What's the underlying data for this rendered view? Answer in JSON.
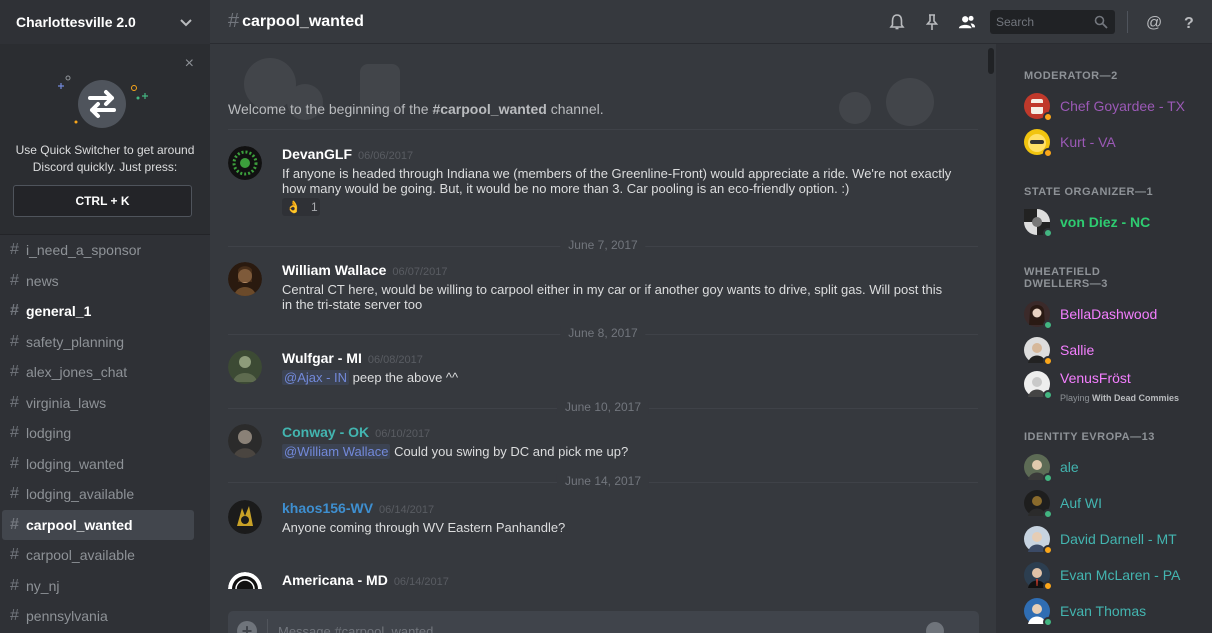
{
  "server": {
    "name": "Charlottesville 2.0"
  },
  "quick_switcher": {
    "text": "Use Quick Switcher to get around Discord quickly. Just press:",
    "shortcut": "CTRL + K",
    "close": "×"
  },
  "channels": [
    {
      "name": "i_need_a_sponsor",
      "state": "normal"
    },
    {
      "name": "news",
      "state": "normal"
    },
    {
      "name": "general_1",
      "state": "unread"
    },
    {
      "name": "safety_planning",
      "state": "normal"
    },
    {
      "name": "alex_jones_chat",
      "state": "normal"
    },
    {
      "name": "virginia_laws",
      "state": "normal"
    },
    {
      "name": "lodging",
      "state": "normal"
    },
    {
      "name": "lodging_wanted",
      "state": "normal"
    },
    {
      "name": "lodging_available",
      "state": "normal"
    },
    {
      "name": "carpool_wanted",
      "state": "active"
    },
    {
      "name": "carpool_available",
      "state": "normal"
    },
    {
      "name": "ny_nj",
      "state": "normal"
    },
    {
      "name": "pennsylvania",
      "state": "normal"
    }
  ],
  "channel_hash": "#",
  "header": {
    "channel": "carpool_wanted",
    "search_placeholder": "Search"
  },
  "welcome": {
    "prefix": "Welcome to the beginning of the ",
    "channel": "#carpool_wanted",
    "suffix": " channel."
  },
  "messages": [
    {
      "author": "DevanGLF",
      "time": "06/06/2017",
      "color": "#ffffff",
      "text": "If anyone is headed through Indiana we (members of the Greenline-Front) would appreciate a ride. We're not exactly how many would be going. But, it would be no more than 3. Car pooling is an eco-friendly option.  :)",
      "reaction": {
        "emoji": "👌",
        "count": "1"
      }
    },
    {
      "author": "William Wallace",
      "time": "06/07/2017",
      "color": "#ffffff",
      "text": "Central CT here, would be willing to carpool either in my car or if another goy wants to drive, split gas. Will post this in the tri-state server too"
    },
    {
      "author": "Wulfgar - MI",
      "time": "06/08/2017",
      "color": "#ffffff",
      "mention": "@Ajax - IN",
      "text": " peep the above ^^"
    },
    {
      "author": "Conway - OK",
      "time": "06/10/2017",
      "color": "#43b5b0",
      "mention": "@William Wallace",
      "text": " Could you swing by DC and pick me up?"
    },
    {
      "author": "khaos156-WV",
      "time": "06/14/2017",
      "color": "#3e8fd0",
      "text": "Anyone coming through WV Eastern Panhandle?"
    },
    {
      "author": "Americana - MD",
      "time": "06/14/2017",
      "color": "#ffffff",
      "text": ""
    }
  ],
  "dividers": [
    "June 7, 2017",
    "June 8, 2017",
    "June 10, 2017",
    "June 14, 2017"
  ],
  "composer": {
    "placeholder": "Message #carpool_wanted"
  },
  "member_groups": [
    {
      "title": "MODERATOR—2"
    },
    {
      "title": "STATE ORGANIZER—1"
    },
    {
      "title": "WHEATFIELD DWELLERS—3"
    },
    {
      "title": "IDENTITY EVROPA—13"
    }
  ],
  "members": [
    {
      "name": "Chef Goyardee - TX",
      "color": "#9b59b6",
      "status": "idle"
    },
    {
      "name": "Kurt - VA",
      "color": "#9b59b6",
      "status": "idle"
    },
    {
      "name": "von Diez - NC",
      "color": "#2ecc71",
      "status": "online"
    },
    {
      "name": "BellaDashwood",
      "color": "#f47fff",
      "status": "online"
    },
    {
      "name": "Sallie",
      "color": "#f47fff",
      "status": "idle"
    },
    {
      "name": "VenusFröst",
      "color": "#f47fff",
      "status": "online",
      "playing_label": "Playing",
      "playing_game": "With Dead Commies"
    },
    {
      "name": "ale",
      "color": "#43b5b0",
      "status": "online"
    },
    {
      "name": "Auf WI",
      "color": "#43b5b0",
      "status": "online"
    },
    {
      "name": "David Darnell - MT",
      "color": "#43b5b0",
      "status": "idle"
    },
    {
      "name": "Evan McLaren - PA",
      "color": "#43b5b0",
      "status": "idle"
    },
    {
      "name": "Evan Thomas",
      "color": "#43b5b0",
      "status": "online"
    }
  ],
  "status_colors": {
    "online": "#43b581",
    "idle": "#faa61a"
  }
}
